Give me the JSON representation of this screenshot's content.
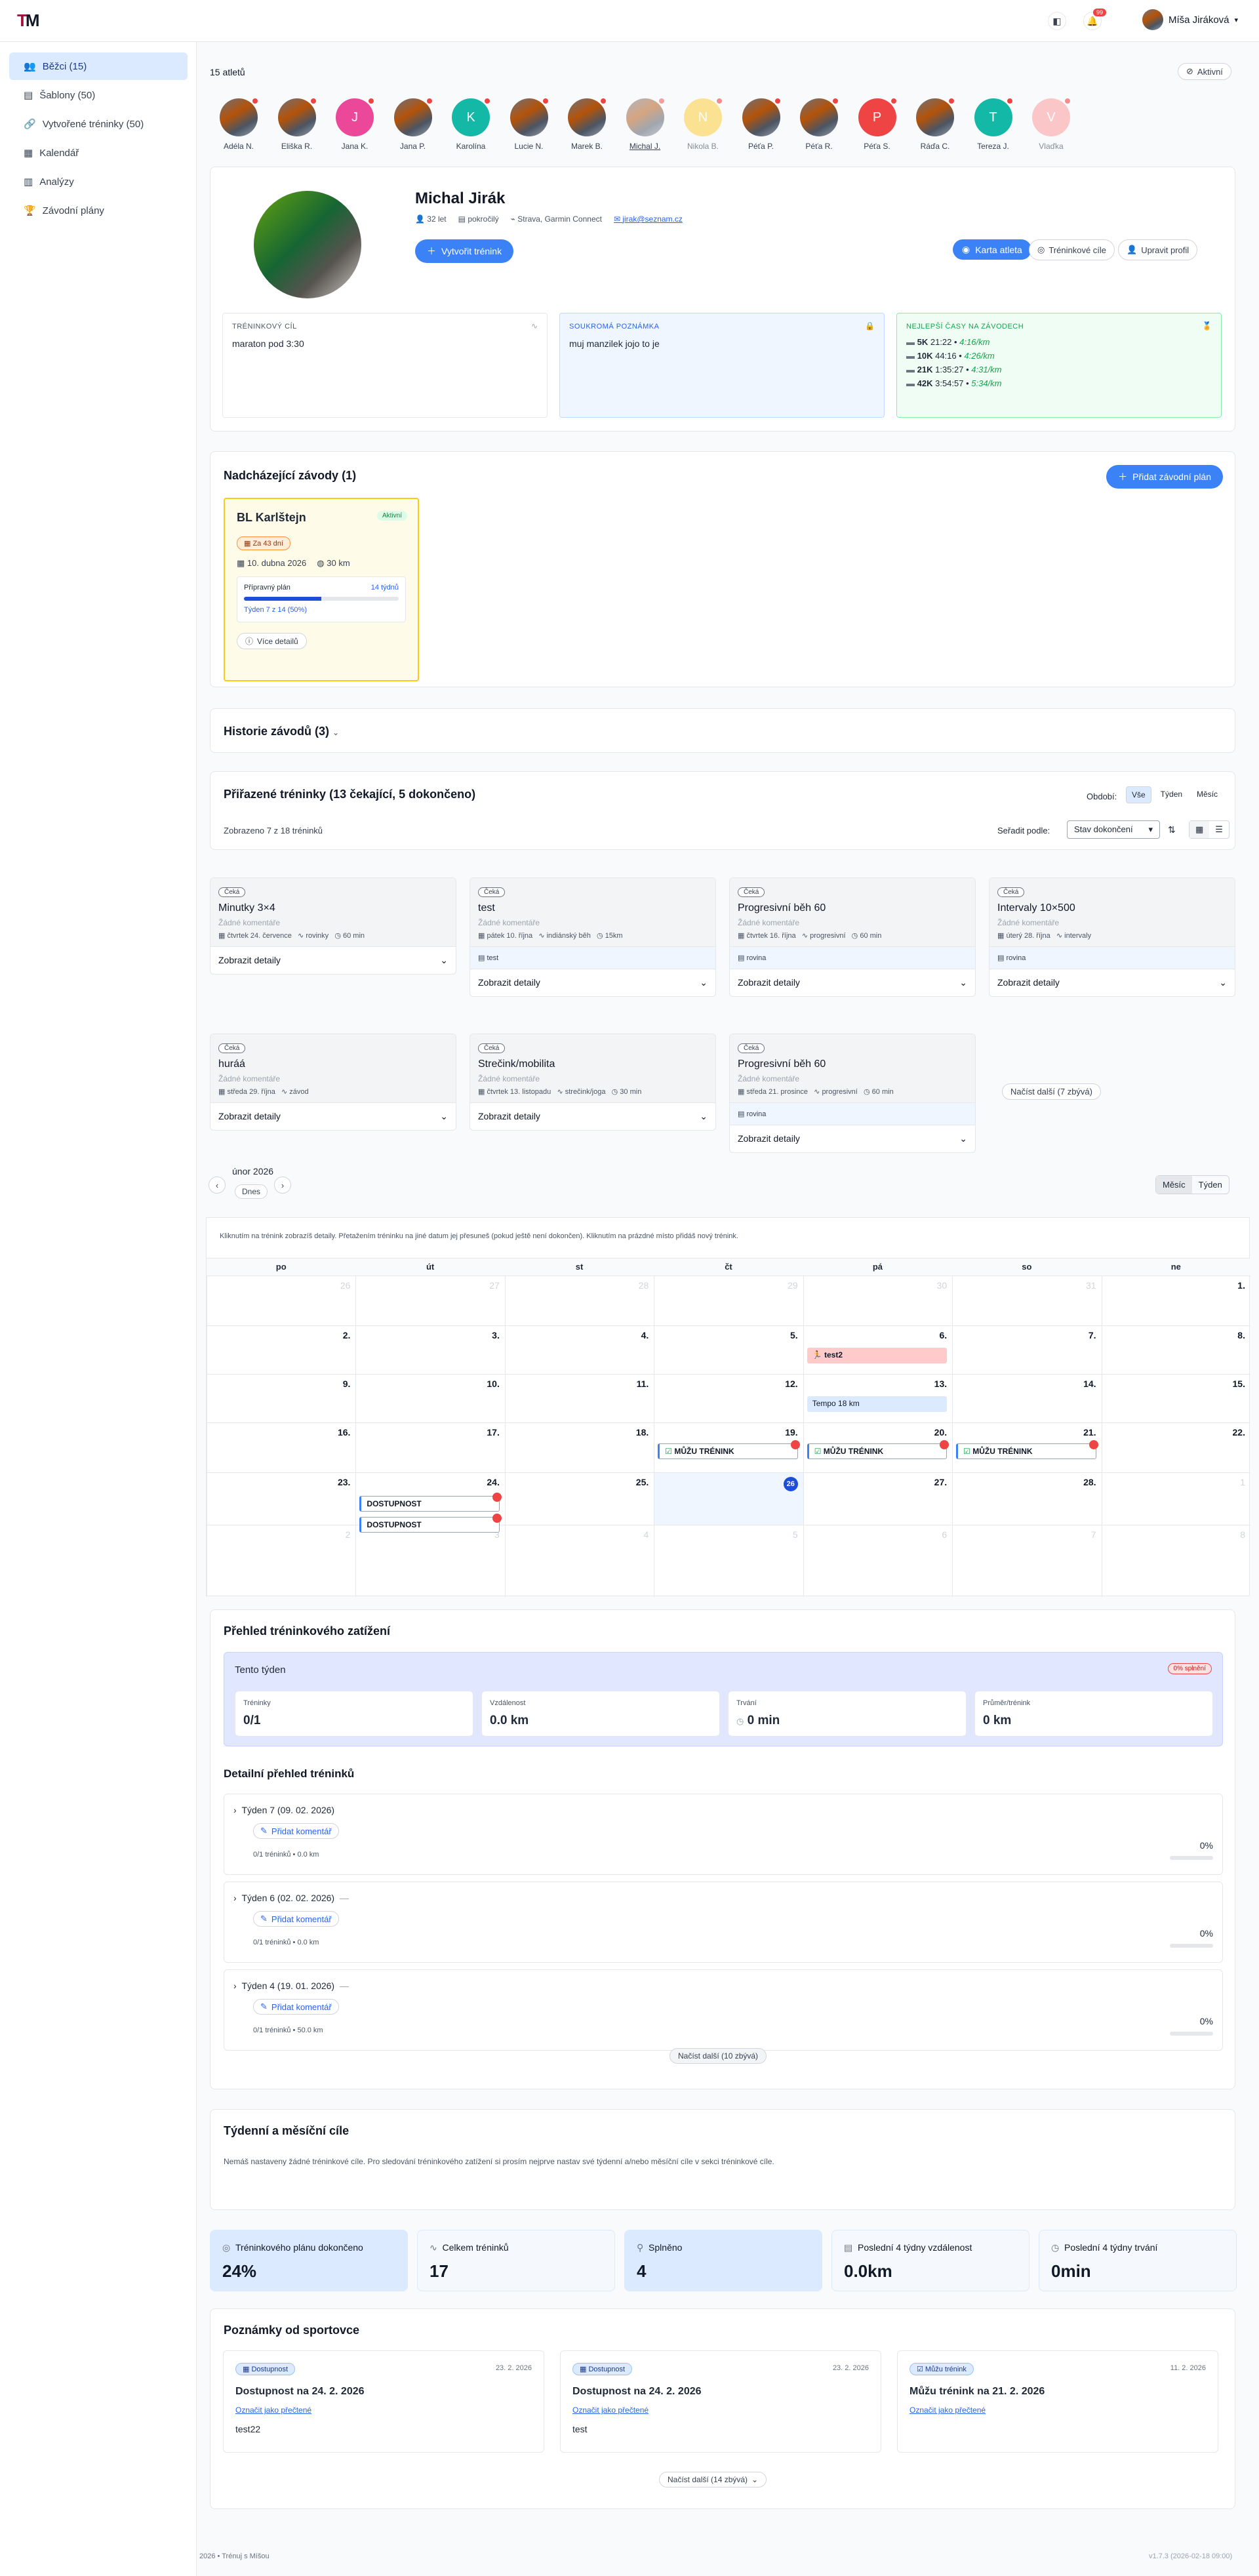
{
  "app": {
    "logo_letters": "TM",
    "user_name": "Míša Jiráková",
    "notif_count": "99"
  },
  "sidebar": {
    "items": [
      {
        "label": "Běžci (15)",
        "icon": "users-icon"
      },
      {
        "label": "Šablony (50)",
        "icon": "template-icon"
      },
      {
        "label": "Vytvořené tréninky (50)",
        "icon": "link-icon"
      },
      {
        "label": "Kalendář",
        "icon": "calendar-icon"
      },
      {
        "label": "Analýzy",
        "icon": "chart-icon"
      },
      {
        "label": "Závodní plány",
        "icon": "trophy-icon"
      }
    ]
  },
  "athletes": {
    "count_label": "15 atletů",
    "filter_label": "Aktivní",
    "list": [
      {
        "name": "Adéla N.",
        "initial": "",
        "color": "photo"
      },
      {
        "name": "Eliška R.",
        "initial": "",
        "color": "photo"
      },
      {
        "name": "Jana K.",
        "initial": "J",
        "color": "#ec4899"
      },
      {
        "name": "Jana P.",
        "initial": "",
        "color": "photo"
      },
      {
        "name": "Karolína",
        "initial": "K",
        "color": "#14b8a6"
      },
      {
        "name": "Lucie N.",
        "initial": "",
        "color": "photo"
      },
      {
        "name": "Marek B.",
        "initial": "",
        "color": "photo"
      },
      {
        "name": "Michal J.",
        "initial": "",
        "color": "photo"
      },
      {
        "name": "Nikola B.",
        "initial": "N",
        "color": "#fcd34d"
      },
      {
        "name": "Péťa P.",
        "initial": "",
        "color": "photo"
      },
      {
        "name": "Péťa R.",
        "initial": "",
        "color": "photo"
      },
      {
        "name": "Péťa S.",
        "initial": "P",
        "color": "#ef4444"
      },
      {
        "name": "Ráďa C.",
        "initial": "",
        "color": "photo"
      },
      {
        "name": "Tereza J.",
        "initial": "T",
        "color": "#14b8a6"
      },
      {
        "name": "Vlaďka",
        "initial": "V",
        "color": "#fca5a5"
      }
    ]
  },
  "profile": {
    "name": "Michal Jirák",
    "age": "32 let",
    "level": "pokročilý",
    "sources": "Strava, Garmin Connect",
    "email": "jirak@seznam.cz",
    "create_btn": "Vytvořit trénink",
    "btn_card": "Karta atleta",
    "btn_goals": "Tréninkové cíle",
    "btn_edit": "Upravit profil",
    "goal_title": "TRÉNINKOVÝ CÍL",
    "goal_text": "maraton pod 3:30",
    "note_title": "SOUKROMÁ POZNÁMKA",
    "note_text": "muj manzilek jojo to je",
    "best_title": "NEJLEPŠÍ ČASY NA ZÁVODECH",
    "best": [
      {
        "dist": "5K",
        "time": "21:22",
        "pace": "4:16/km"
      },
      {
        "dist": "10K",
        "time": "44:16",
        "pace": "4:26/km"
      },
      {
        "dist": "21K",
        "time": "1:35:27",
        "pace": "4:31/km"
      },
      {
        "dist": "42K",
        "time": "3:54:57",
        "pace": "5:34/km"
      }
    ]
  },
  "races": {
    "title": "Nadcházející závody (1)",
    "add_btn": "Přidat závodní plán",
    "race": {
      "name": "BL Karlštejn",
      "status": "Aktivní",
      "countdown": "Za 43 dní",
      "date": "10. dubna 2026",
      "distance": "30 km",
      "plan_label": "Přípravný plán",
      "plan_weeks": "14 týdnů",
      "progress": 0.5,
      "progress_text": "Týden 7 z 14 (50%)",
      "details_btn": "Více detailů"
    },
    "history_title": "Historie závodů (3)"
  },
  "trainings": {
    "title": "Přiřazené tréninky (13 čekající, 5 dokončeno)",
    "period_label": "Období:",
    "period_options": [
      "Vše",
      "Týden",
      "Měsíc"
    ],
    "shown_text": "Zobrazeno 7 z 18 tréninků",
    "sort_label": "Seřadit podle:",
    "sort_value": "Stav dokončení",
    "load_more": "Načíst další (7 zbývá)",
    "detail_label": "Zobrazit detaily",
    "status": "Čeká",
    "no_comments": "Žádné komentáře",
    "cards": [
      {
        "title": "Minutky 3×4",
        "date": "čtvrtek 24. července",
        "type": "rovinky",
        "dur": "60 min",
        "note": ""
      },
      {
        "title": "test",
        "date": "pátek 10. října",
        "type": "indiánský běh",
        "dur": "15km",
        "note": "test"
      },
      {
        "title": "Progresivní běh 60",
        "date": "čtvrtek 16. října",
        "type": "progresivní",
        "dur": "60 min",
        "note": "rovina"
      },
      {
        "title": "Intervaly 10×500",
        "date": "úterý 28. října",
        "type": "intervaly",
        "dur": "",
        "note": "rovina"
      },
      {
        "title": "huráá",
        "date": "středa 29. října",
        "type": "závod",
        "dur": "",
        "note": ""
      },
      {
        "title": "Strečink/mobilita",
        "date": "čtvrtek 13. listopadu",
        "type": "strečink/joga",
        "dur": "30 min",
        "note": ""
      },
      {
        "title": "Progresivní běh 60",
        "date": "středa 21. prosince",
        "type": "progresivní",
        "dur": "60 min",
        "note": "rovina"
      }
    ]
  },
  "calendar": {
    "month": "únor 2026",
    "today_btn": "Dnes",
    "view_month": "Měsíc",
    "view_week": "Týden",
    "hint": "Kliknutím na trénink zobrazíš detaily. Přetažením tréninku na jiné datum jej přesuneš (pokud ještě není dokončen). Kliknutím na prázdné místo přidáš nový trénink.",
    "weekdays": [
      "po",
      "út",
      "st",
      "čt",
      "pá",
      "so",
      "ne"
    ],
    "weeks": [
      [
        "26",
        "27",
        "28",
        "29",
        "30",
        "31",
        "1"
      ],
      [
        "2",
        "3",
        "4",
        "5",
        "6",
        "7",
        "8"
      ],
      [
        "9",
        "10",
        "11",
        "12",
        "13",
        "14",
        "15"
      ],
      [
        "16",
        "17",
        "18",
        "19",
        "20",
        "21",
        "22"
      ],
      [
        "23",
        "24",
        "25",
        "26",
        "27",
        "28",
        "1"
      ],
      [
        "2",
        "3",
        "4",
        "5",
        "6",
        "7",
        "8"
      ]
    ],
    "events": {
      "race": "test2",
      "tempo": "Tempo 18 km",
      "can": "MŮŽU TRÉNINK",
      "avail": "DOSTUPNOST"
    }
  },
  "load": {
    "title": "Přehled tréninkového zatížení",
    "week_title": "Tento týden",
    "week_badge": "0% splnění",
    "stats": [
      {
        "label": "Tréninky",
        "value": "0/1"
      },
      {
        "label": "Vzdálenost",
        "value": "0.0 km"
      },
      {
        "label": "Trvání",
        "value": "0 min"
      },
      {
        "label": "Průměr/trénink",
        "value": "0 km"
      }
    ],
    "detail_title": "Detailní přehled tréninků",
    "add_comment": "Přidat komentář",
    "weeks": [
      {
        "title": "Týden 7 (09. 02. 2026)",
        "info": "0/1 tréninků • 0.0 km",
        "pct": "0%"
      },
      {
        "title": "Týden 6 (02. 02. 2026)",
        "info": "0/1 tréninků • 0.0 km",
        "pct": "0%"
      },
      {
        "title": "Týden 4 (19. 01. 2026)",
        "info": "0/1 tréninků • 50.0 km",
        "pct": "0%"
      }
    ],
    "load_more": "Načíst další (10 zbývá)"
  },
  "goals": {
    "title": "Týdenní a měsíční cíle",
    "text": "Nemáš nastaveny žádné tréninkové cíle. Pro sledování tréninkového zatížení si prosím nejprve nastav své týdenní a/nebo měsíční cíle v sekci tréninkové cíle."
  },
  "summary": [
    {
      "label": "Tréninkového plánu dokončeno",
      "value": "24%"
    },
    {
      "label": "Celkem tréninků",
      "value": "17"
    },
    {
      "label": "Splněno",
      "value": "4"
    },
    {
      "label": "Poslední 4 týdny vzdálenost",
      "value": "0.0km"
    },
    {
      "label": "Poslední 4 týdny trvání",
      "value": "0min"
    }
  ],
  "notes": {
    "title": "Poznámky od sportovce",
    "mark_read": "Označit jako přečtené",
    "load_more": "Načíst další (14 zbývá)",
    "items": [
      {
        "badge": "Dostupnost",
        "date": "23. 2. 2026",
        "title": "Dostupnost na 24. 2. 2026",
        "text": "test22"
      },
      {
        "badge": "Dostupnost",
        "date": "23. 2. 2026",
        "title": "Dostupnost na 24. 2. 2026",
        "text": "test"
      },
      {
        "badge": "Můžu trénink",
        "date": "11. 2. 2026",
        "title": "Můžu trénink na 21. 2. 2026",
        "text": ""
      }
    ]
  },
  "footer": {
    "left": "2026 • Trénuj s Míšou",
    "right": "v1.7.3 (2026-02-18 09:00)"
  }
}
